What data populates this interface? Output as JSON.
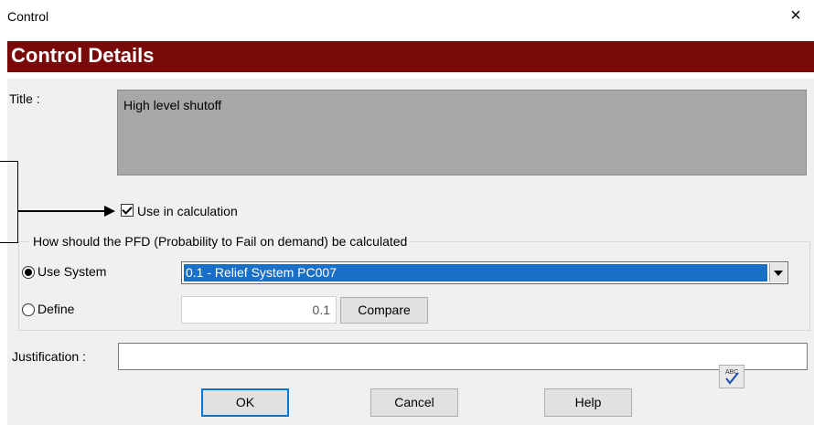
{
  "window": {
    "title": "Control",
    "close_glyph": "×"
  },
  "header": {
    "title": "Control Details"
  },
  "form": {
    "title_label": "Title :",
    "title_value": "High level shutoff",
    "use_in_calc_label": "Use in calculation",
    "use_in_calc_checked": true,
    "pfd_group_title": "How should the PFD (Probability to Fail on demand)  be calculated",
    "use_system_label": "Use System",
    "use_system_selected": true,
    "system_select_value": "0.1 - Relief System PC007",
    "define_label": "Define",
    "define_selected": false,
    "define_value": "0.1",
    "compare_label": "Compare",
    "justification_label": "Justification :",
    "justification_value": ""
  },
  "buttons": {
    "ok": "OK",
    "cancel": "Cancel",
    "help": "Help",
    "spellcheck_icon": "spellcheck-icon"
  },
  "colors": {
    "header_bg": "#7a0a0a",
    "selection": "#1a6fc6",
    "default_button_border": "#0078d7"
  }
}
